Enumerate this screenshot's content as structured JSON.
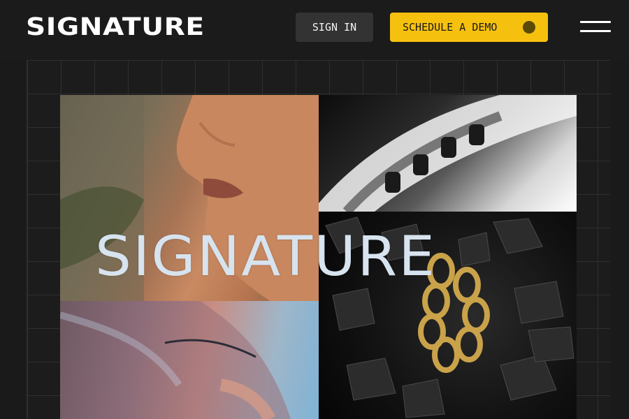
{
  "header": {
    "logo": "SIGNATURE",
    "sign_in_label": "SIGN IN",
    "demo_label": "SCHEDULE A DEMO",
    "menu_icon": "hamburger-menu-icon"
  },
  "hero": {
    "collage_title": "SIGNATURE",
    "tiles": [
      {
        "name": "face-closeup-photo",
        "description_icon": "image"
      },
      {
        "name": "metallic-gear-photo",
        "description_icon": "image"
      },
      {
        "name": "gold-chain-on-black-rocks-photo",
        "description_icon": "image"
      },
      {
        "name": "iridescent-face-photo",
        "description_icon": "image"
      }
    ]
  },
  "colors": {
    "background": "#1a1a1a",
    "accent": "#f6c10e",
    "signin_bg": "#333333",
    "text": "#ffffff"
  }
}
